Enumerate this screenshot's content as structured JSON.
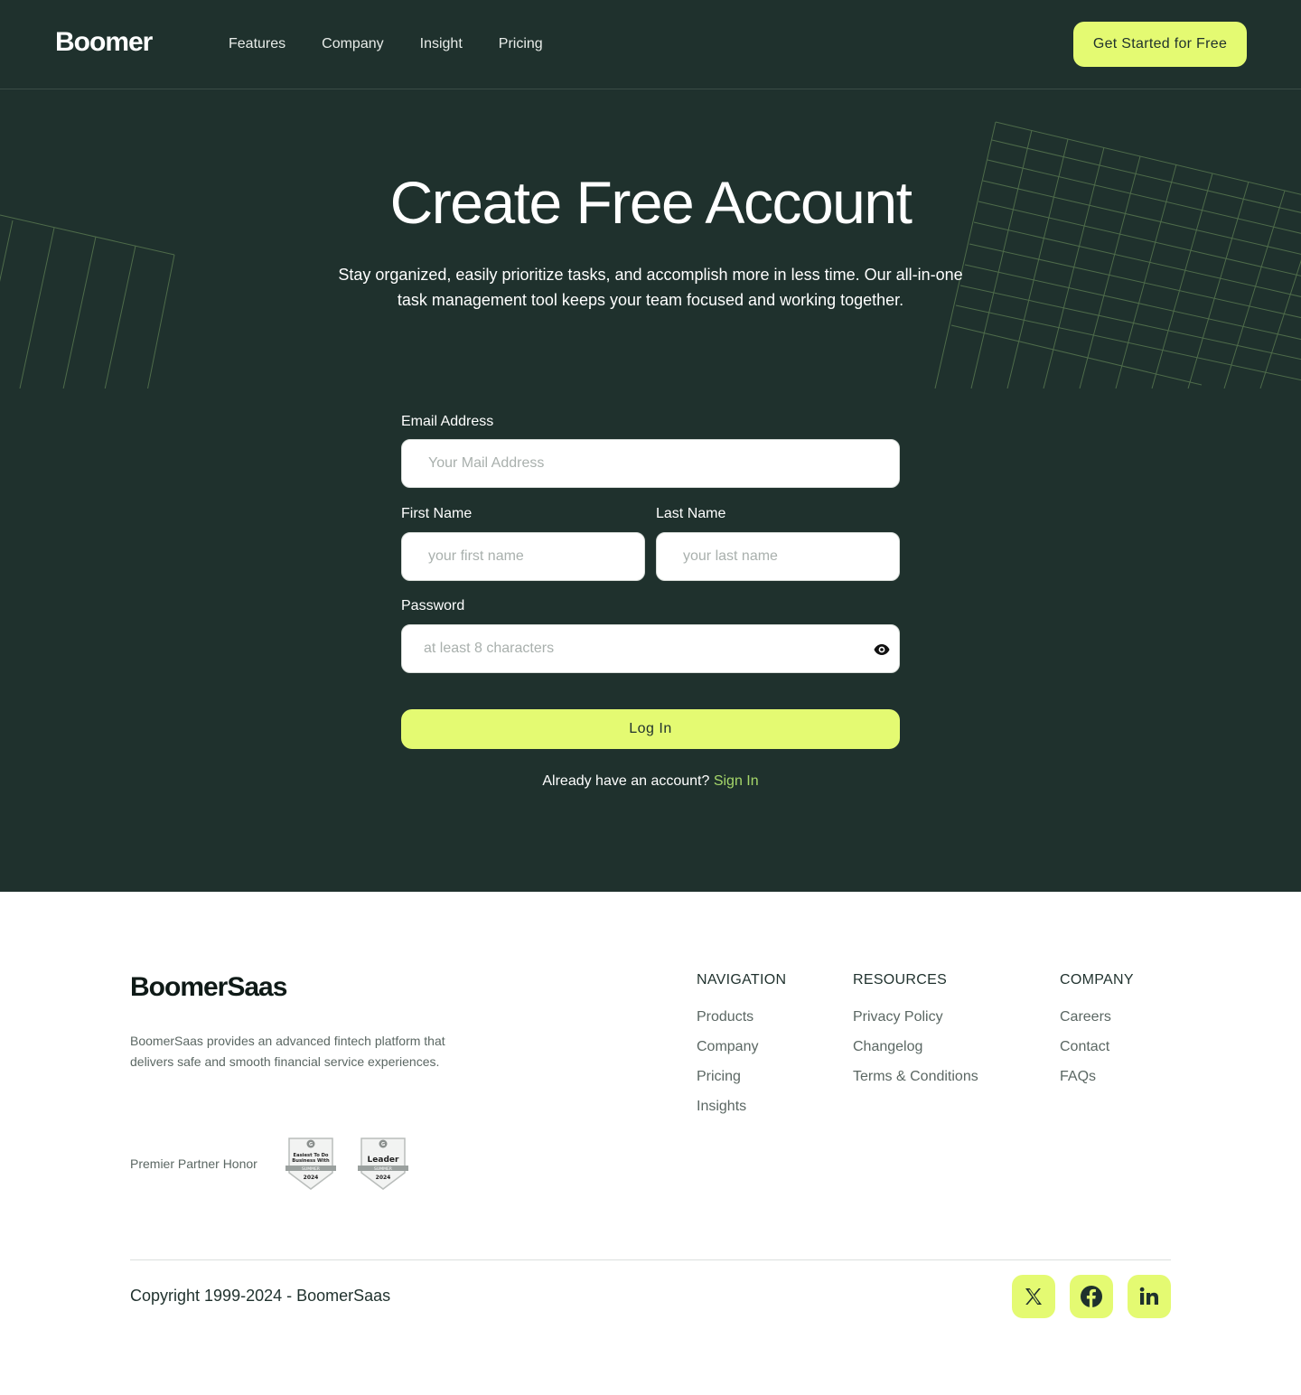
{
  "header": {
    "logo": "Boomer",
    "nav": [
      "Features",
      "Company",
      "Insight",
      "Pricing"
    ],
    "cta_label": "Get Started for Free"
  },
  "hero": {
    "title": "Create Free Account",
    "subtitle": "Stay organized, easily prioritize tasks, and accomplish more in less time. Our all-in-one task management tool keeps your team focused and working together."
  },
  "form": {
    "email": {
      "label": "Email Address",
      "placeholder": "Your Mail Address",
      "value": ""
    },
    "first_name": {
      "label": "First Name",
      "placeholder": "your first name",
      "value": ""
    },
    "last_name": {
      "label": "Last Name",
      "placeholder": "your last name",
      "value": ""
    },
    "password": {
      "label": "Password",
      "placeholder": "at least 8 characters",
      "value": "",
      "toggle_icon": "eye-icon"
    },
    "submit_label": "Log In",
    "signin_prompt": "Already have an account?",
    "signin_link": "Sign In"
  },
  "footer": {
    "logo": "BoomerSaas",
    "description": "BoomerSaas provides an advanced fintech platform that delivers safe and smooth financial service experiences.",
    "partner_label": "Premier Partner Honor",
    "badges": [
      {
        "top": "Easiest To Do Business With",
        "season": "SUMMER",
        "year": "2024"
      },
      {
        "top": "Leader",
        "season": "SUMMER",
        "year": "2024"
      }
    ],
    "columns": [
      {
        "title": "NAVIGATION",
        "links": [
          "Products",
          "Company",
          "Pricing",
          "Insights"
        ]
      },
      {
        "title": "RESOURCES",
        "links": [
          "Privacy Policy",
          "Changelog",
          "Terms & Conditions"
        ]
      },
      {
        "title": "COMPANY",
        "links": [
          "Careers",
          "Contact",
          "FAQs"
        ]
      }
    ],
    "copyright": "Copyright 1999-2024 - BoomerSaas",
    "social": [
      "x-icon",
      "facebook-icon",
      "linkedin-icon"
    ]
  },
  "colors": {
    "dark_bg": "#1f312d",
    "accent": "#e4fa72",
    "link_green": "#a6d76a"
  }
}
